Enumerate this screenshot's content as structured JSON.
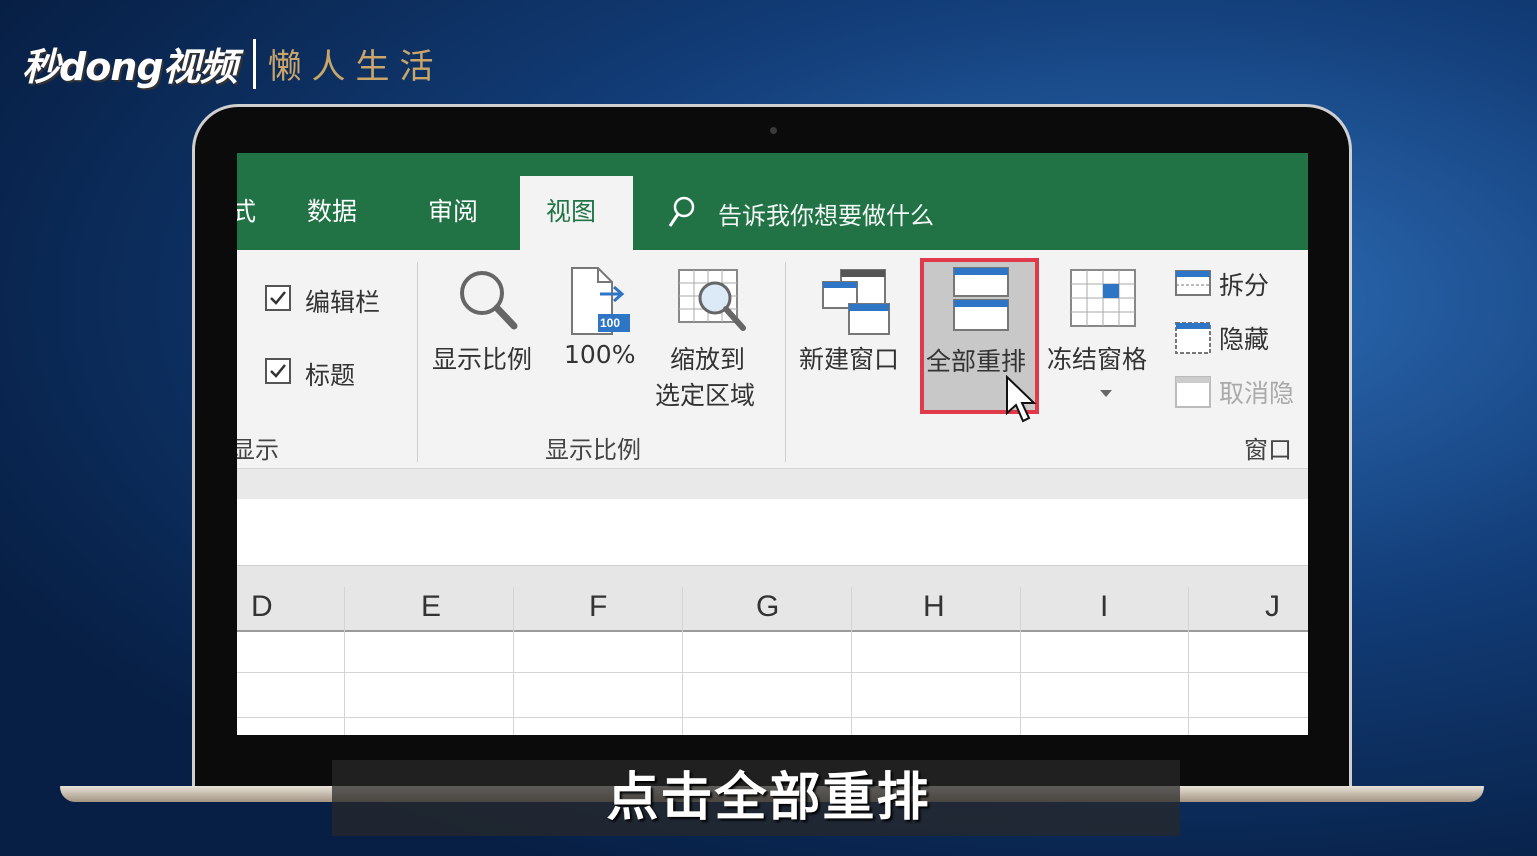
{
  "brand": {
    "logo_text": "秒dong视频",
    "channel": "懒人生活"
  },
  "excel": {
    "tabs": {
      "partial": "式",
      "data": "数据",
      "review": "审阅",
      "view": "视图"
    },
    "tell_me": "告诉我你想要做什么",
    "show_group": {
      "formula_bar_label": "编辑栏",
      "formula_bar_checked": true,
      "headings_label": "标题",
      "headings_checked": true,
      "group_label": "显示"
    },
    "zoom_group": {
      "zoom_label": "显示比例",
      "hundred_label": "100%",
      "hundred_badge": "100",
      "zoom_selection_label_1": "缩放到",
      "zoom_selection_label_2": "选定区域",
      "group_label": "显示比例"
    },
    "window_group": {
      "new_window_label": "新建窗口",
      "arrange_all_label": "全部重排",
      "freeze_panes_label": "冻结窗格",
      "split_label": "拆分",
      "hide_label": "隐藏",
      "unhide_label": "取消隐",
      "group_label": "窗口"
    },
    "columns": [
      "D",
      "E",
      "F",
      "G",
      "H",
      "I",
      "J"
    ]
  },
  "subtitle": "点击全部重排",
  "colors": {
    "excel_green": "#217346",
    "highlight_red": "#e0394a"
  }
}
